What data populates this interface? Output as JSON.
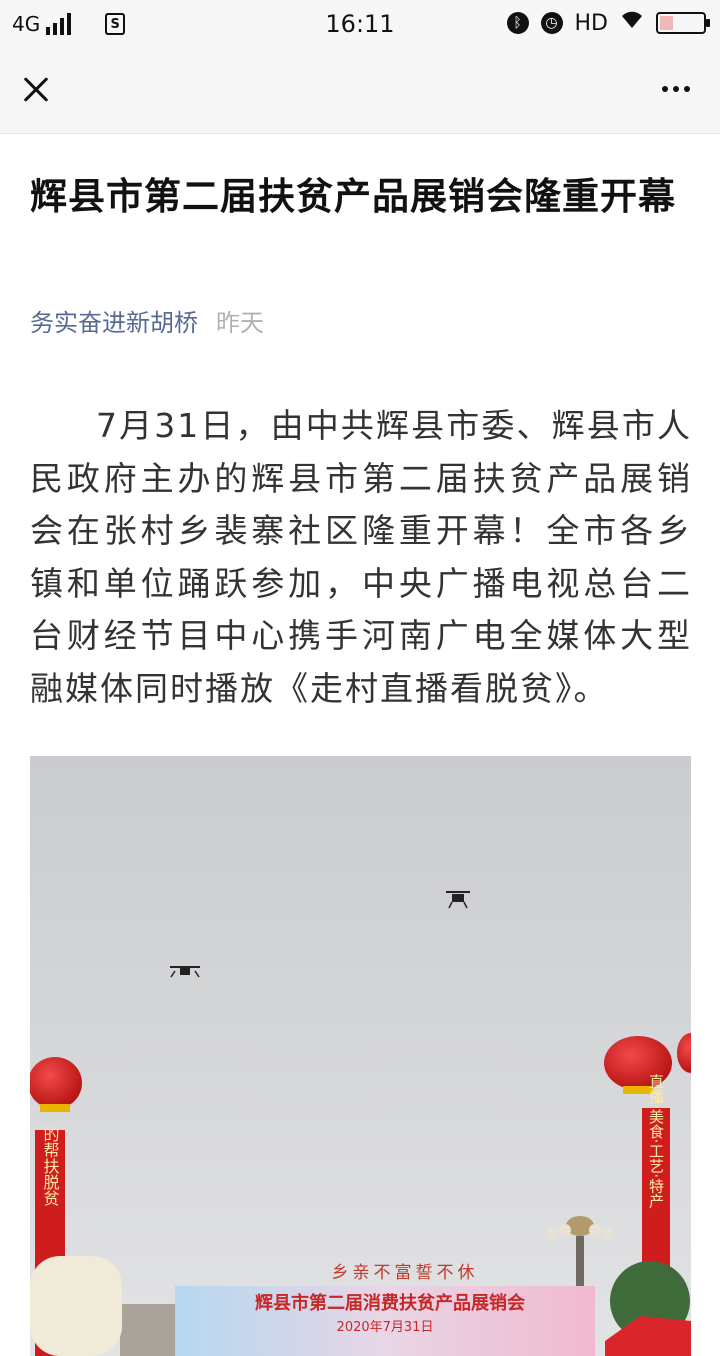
{
  "status_bar": {
    "network": "4G",
    "sim": "S",
    "time": "16:11",
    "hd": "HD",
    "battery_level": 0.3,
    "icons": [
      "signal-icon",
      "sim-icon",
      "bluetooth-icon",
      "alarm-icon",
      "wifi-icon",
      "battery-icon"
    ]
  },
  "nav": {
    "close_icon": "close-icon",
    "more_icon": "more-icon"
  },
  "article": {
    "title": "辉县市第二届扶贫产品展销会隆重开幕",
    "author": "务实奋进新胡桥",
    "date": "昨天",
    "paragraph": "7月31日，由中共辉县市委、辉县市人民政府主办的辉县市第二届扶贫产品展销会在张村乡裴寨社区隆重开幕！全市各乡镇和单位踊跃参加，中央广播电视总台二台财经节目中心携手河南广电全媒体大型融媒体同时播放《走村直播看脱贫》。"
  },
  "photo": {
    "slogan": "乡亲不富誓不休",
    "banner_title": "辉县市第二届消费扶贫产品展销会",
    "banner_date": "2020年7月31日",
    "left_banner": "的帮扶脱贫",
    "right_banner": "直播·美食·工艺·特产"
  },
  "colors": {
    "accent_link": "#576b95",
    "date_gray": "#b2b2b2",
    "lantern_red": "#d81e1e"
  }
}
